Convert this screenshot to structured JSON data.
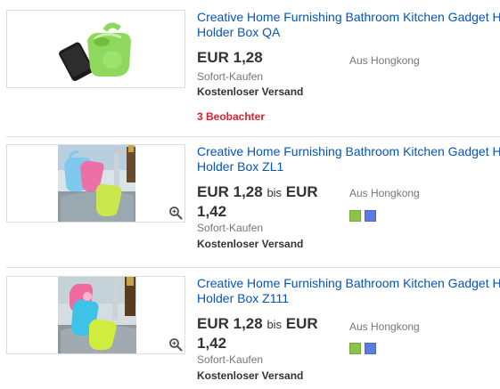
{
  "listings": [
    {
      "title_line1": "Creative Home Furnishing Bathroom Kitchen Gadget H",
      "title_line2": "Holder Box QA",
      "price": "EUR 1,28",
      "buy_type": "Sofort-Kaufen",
      "shipping": "Kostenloser Versand",
      "watchers": "3 Beobachter",
      "location": "Aus Hongkong"
    },
    {
      "title_line1": "Creative Home Furnishing Bathroom Kitchen Gadget H",
      "title_line2": "Holder Box ZL1",
      "price_from": "EUR 1,28",
      "price_sep": "bis",
      "price_to_part1": "EUR",
      "price_to_part2": "1,42",
      "buy_type": "Sofort-Kaufen",
      "shipping": "Kostenloser Versand",
      "location": "Aus Hongkong",
      "swatches": [
        "#8bc34a",
        "#5b7be0"
      ]
    },
    {
      "title_line1": "Creative Home Furnishing Bathroom Kitchen Gadget H",
      "title_line2": "Holder Box Z111",
      "price_from": "EUR 1,28",
      "price_sep": "bis",
      "price_to_part1": "EUR",
      "price_to_part2": "1,42",
      "buy_type": "Sofort-Kaufen",
      "shipping": "Kostenloser Versand",
      "location": "Aus Hongkong",
      "swatches": [
        "#8bc34a",
        "#5b7be0"
      ]
    }
  ],
  "colors": {
    "link": "#0654ba",
    "watchers": "#dd1e31",
    "muted": "#767676"
  },
  "icons": {
    "zoom": "zoom-magnifier-icon"
  }
}
